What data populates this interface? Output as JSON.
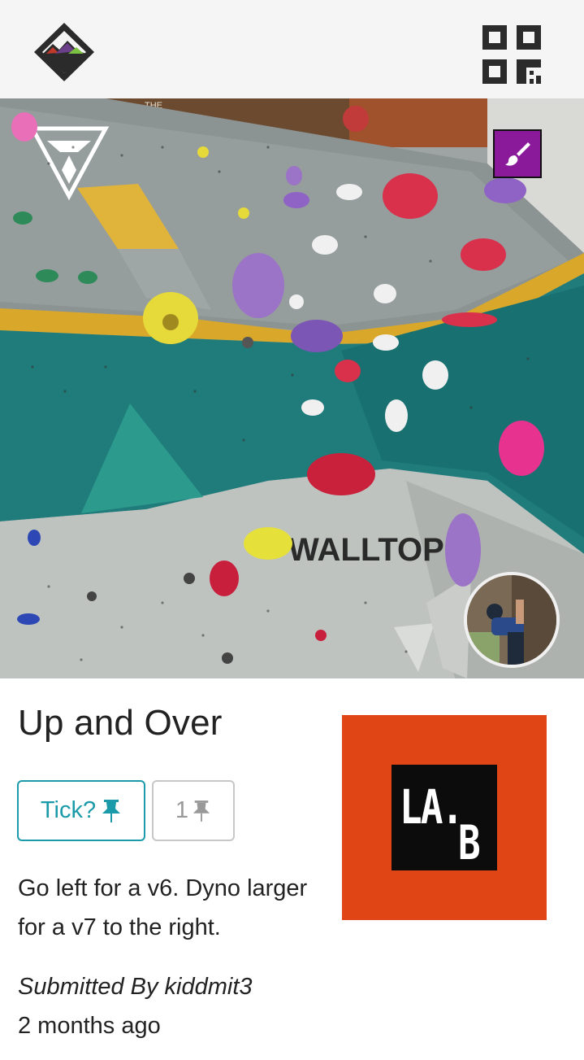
{
  "header": {
    "logo_icon": "mountain-logo-icon",
    "qr_icon": "qr-code-icon"
  },
  "photo": {
    "alt_icon": "climbing-wall-photo",
    "wall_sign": "WALLTOP",
    "wall_top_text": "THE",
    "setter_badge_icon": "paintbrush-icon",
    "setter_badge_color": "#8b1a9b",
    "avatar_icon": "climber-avatar"
  },
  "route": {
    "title": "Up and Over",
    "tick_label": "Tick?",
    "tick_icon": "pin-icon",
    "tick_count": "1",
    "description": "Go left for a v6. Dyno larger for a v7 to the right.",
    "submitted_by": "Submitted By kiddmit3",
    "time_ago": "2 months ago"
  },
  "gym": {
    "logo_text": "LA.",
    "logo_sub": "B",
    "logo_bg": "#e04515"
  },
  "colors": {
    "accent": "#1b9aaa",
    "muted_border": "#c7c7c7"
  }
}
